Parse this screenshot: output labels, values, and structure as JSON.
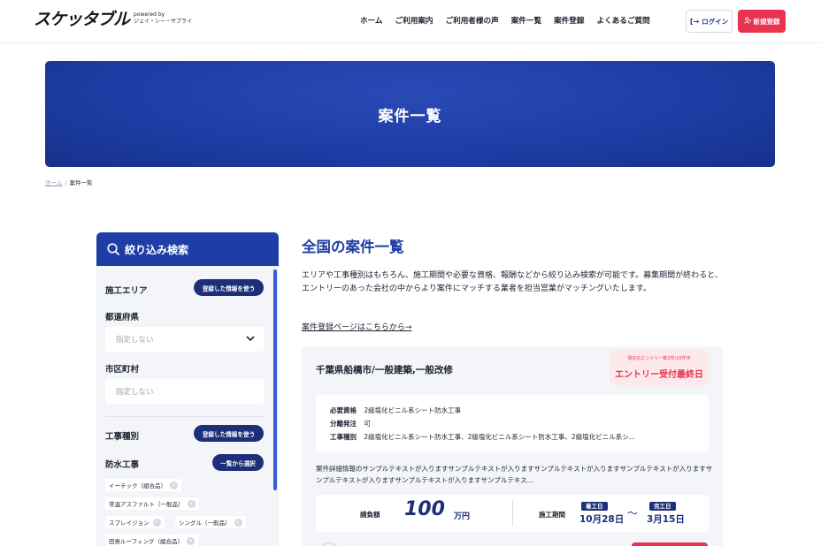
{
  "header": {
    "logo": "スケッタブル",
    "logo_sub": [
      "powered by",
      "ジェイ・シー・サプライ"
    ],
    "nav": [
      "ホーム",
      "ご利用案内",
      "ご利用者様の声",
      "案件一覧",
      "案件登録",
      "よくあるご質問"
    ],
    "login": "ログイン",
    "register": "新規登録"
  },
  "hero": {
    "title": "案件一覧"
  },
  "breadcrumb": {
    "home": "ホーム",
    "sep": "/",
    "current": "案件一覧"
  },
  "sidebar": {
    "title": "絞り込み検索",
    "area_label": "施工エリア",
    "use_saved": "登録した情報を使う",
    "pref_label": "都道府県",
    "pref_placeholder": "指定しない",
    "city_label": "市区町村",
    "city_placeholder": "指定しない",
    "work_type_label": "工事種別",
    "work_use_saved": "登録した情報を使う",
    "waterproof_label": "防水工事",
    "select_from_list": "一覧から選択",
    "tags": [
      "イーテック（組合品）",
      "常温アスファルト（一般品）",
      "スプレイジョン",
      "シングル（一般品）",
      "田島ルーフィング（組合品）"
    ]
  },
  "main": {
    "title": "全国の案件一覧",
    "description": "エリアや工事種別はもちろん、施工期間や必要な資格、報酬などから絞り込み検索が可能です。募集期間が終わると、エントリーのあった会社の中からより案件にマッチする業者を担当営業がマッチングいたします。",
    "register_link": "案件登録ページはこちらから→"
  },
  "card": {
    "title": "千葉県船橋市/一般建築,一般改修",
    "entry_count": "現在のエントリー数2件/10件中",
    "status": "エントリー受付最終日",
    "requirements": [
      {
        "key": "必要資格",
        "value": "2級塩化ビニル系シート防水工事"
      },
      {
        "key": "分離発注",
        "value": "可"
      },
      {
        "key": "工事種別",
        "value": "2級塩化ビニル系シート防水工事、2級塩化ビニル系シート防水工事、2級塩化ビニル系シ..."
      }
    ],
    "detail": "案件詳細情報のサンプルテキストが入りますサンプルテキストが入りますサンプルテキストが入りますサンプルテキストが入りますサンプルテキストが入りますサンプルテキストが入りますサンプルテキス...",
    "price_label": "請負額",
    "price_amount": "100",
    "price_unit": "万円",
    "period_label": "施工期間",
    "start_label": "着工日",
    "start_date": "10月28日",
    "tilde": "〜",
    "end_label": "完工日",
    "end_date": "3月15日"
  },
  "colors": {
    "primary": "#1e3ea6",
    "navy": "#1c2f78",
    "accent": "#e8344e",
    "panel": "#f3f5f9"
  }
}
